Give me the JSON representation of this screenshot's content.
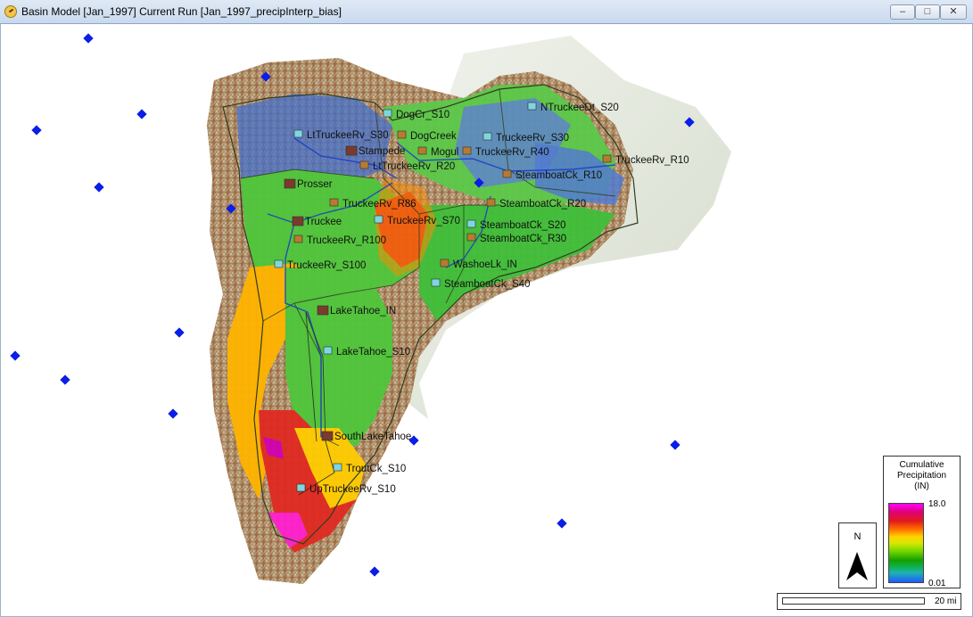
{
  "window": {
    "title": "Basin Model [Jan_1997] Current Run [Jan_1997_precipInterp_bias]",
    "minimize_glyph": "–",
    "maximize_glyph": "□",
    "close_glyph": "✕"
  },
  "map": {
    "element_labels": [
      "DogCr_S10",
      "NTruckeeDt_S20",
      "LtTruckeeRv_S30",
      "DogCreek",
      "TruckeeRv_S30",
      "Stampede",
      "Mogul",
      "TruckeeRv_R40",
      "TruckeeRv_R10",
      "LtTruckeeRv_R20",
      "SteamboatCk_R10",
      "Prosser",
      "TruckeeRv_R86",
      "SteamboatCk_R20",
      "Truckee",
      "TruckeeRv_S70",
      "SteamboatCk_S20",
      "TruckeeRv_R100",
      "SteamboatCk_R30",
      "TruckeeRv_S100",
      "WashoeLk_IN",
      "SteamboatCk_S40",
      "LakeTahoe_IN",
      "LakeTahoe_S10",
      "SouthLakeTahoe",
      "TroutCk_S10",
      "UpTruckeeRv_S10"
    ],
    "gage_count": 16
  },
  "legend": {
    "title": "Cumulative Precipitation (IN)",
    "title_line1": "Cumulative",
    "title_line2": "Precipitation",
    "title_line3": "(IN)",
    "max": "18.0",
    "min": "0.01",
    "colors": [
      "#ff00ff",
      "#e0007a",
      "#e21a1a",
      "#ff6a00",
      "#ffd400",
      "#79d800",
      "#14a000",
      "#1fb2b2",
      "#1e5bff"
    ]
  },
  "north_arrow": {
    "label": "N"
  },
  "scale": {
    "label": "20 mi"
  },
  "colors": {
    "gage": "#0a1ee6",
    "outline": "#2f3d1f",
    "stream": "#1a3cc8",
    "terrain_high": "#b86a3a",
    "terrain_low": "#e9efe4"
  }
}
